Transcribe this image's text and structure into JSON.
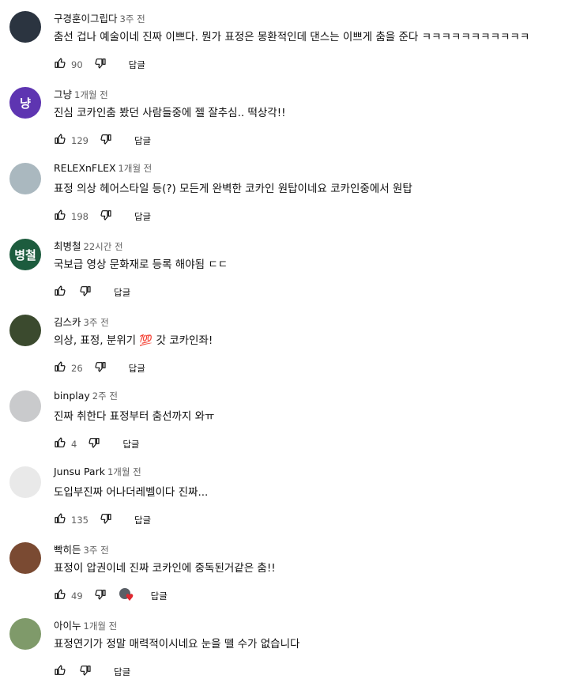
{
  "labels": {
    "reply": "답글"
  },
  "comments": [
    {
      "author": "구경훈이그립다",
      "time": "3주 전",
      "text": "춤선 겁나 예술이네 진짜 이쁘다. 뭔가 표정은 몽환적인데 댄스는 이쁘게 춤을 준다 ㅋㅋㅋㅋㅋㅋㅋㅋㅋㅋㅋ",
      "likes": "90",
      "avatar_text": "",
      "avatar_color": "#2b3440"
    },
    {
      "author": "그냥",
      "time": "1개월 전",
      "text": "진심 코카인춤 봤던 사람들중에 젤 잘추심.. 떡상각!!",
      "likes": "129",
      "avatar_text": "냥",
      "avatar_color": "#5e35b1"
    },
    {
      "author": "RELEXnFLEX",
      "time": "1개월 전",
      "text": "표정 의상 헤어스타일 등(?) 모든게 완벽한 코카인 원탑이네요 코카인중에서 원탑",
      "likes": "198",
      "avatar_text": "",
      "avatar_color": "#aab8bf"
    },
    {
      "author": "최병철",
      "time": "22시간 전",
      "text": "국보급 영상 문화재로 등록 해야됨 ㄷㄷ",
      "likes": "",
      "avatar_text": "병철",
      "avatar_color": "#1d5c3e"
    },
    {
      "author": "김스카",
      "time": "3주 전",
      "text": "의상, 표정, 분위기 💯 갓 코카인좌!",
      "likes": "26",
      "avatar_text": "",
      "avatar_color": "#3b4a2e"
    },
    {
      "author": "binplay",
      "time": "2주 전",
      "text": "진짜 취한다 표정부터 춤선까지  와ㅠ",
      "likes": "4",
      "avatar_text": "",
      "avatar_color": "#c9cacc"
    },
    {
      "author": "Junsu Park",
      "time": "1개월 전",
      "text": "도입부진짜 어나더레벨이다 진짜...",
      "likes": "135",
      "avatar_text": "",
      "avatar_color": "#e9e9e9"
    },
    {
      "author": "빡히든",
      "time": "3주 전",
      "text": "표정이 압권이네 진짜 코카인에 중독된거같은 춤!!",
      "likes": "49",
      "avatar_text": "",
      "avatar_color": "#7a4a32",
      "hearted": true
    },
    {
      "author": "아이누",
      "time": "1개월 전",
      "text": "표정연기가 정말 매력적이시네요 눈을 뗄 수가 없습니다",
      "likes": "",
      "avatar_text": "",
      "avatar_color": "#7f9a6a"
    }
  ]
}
